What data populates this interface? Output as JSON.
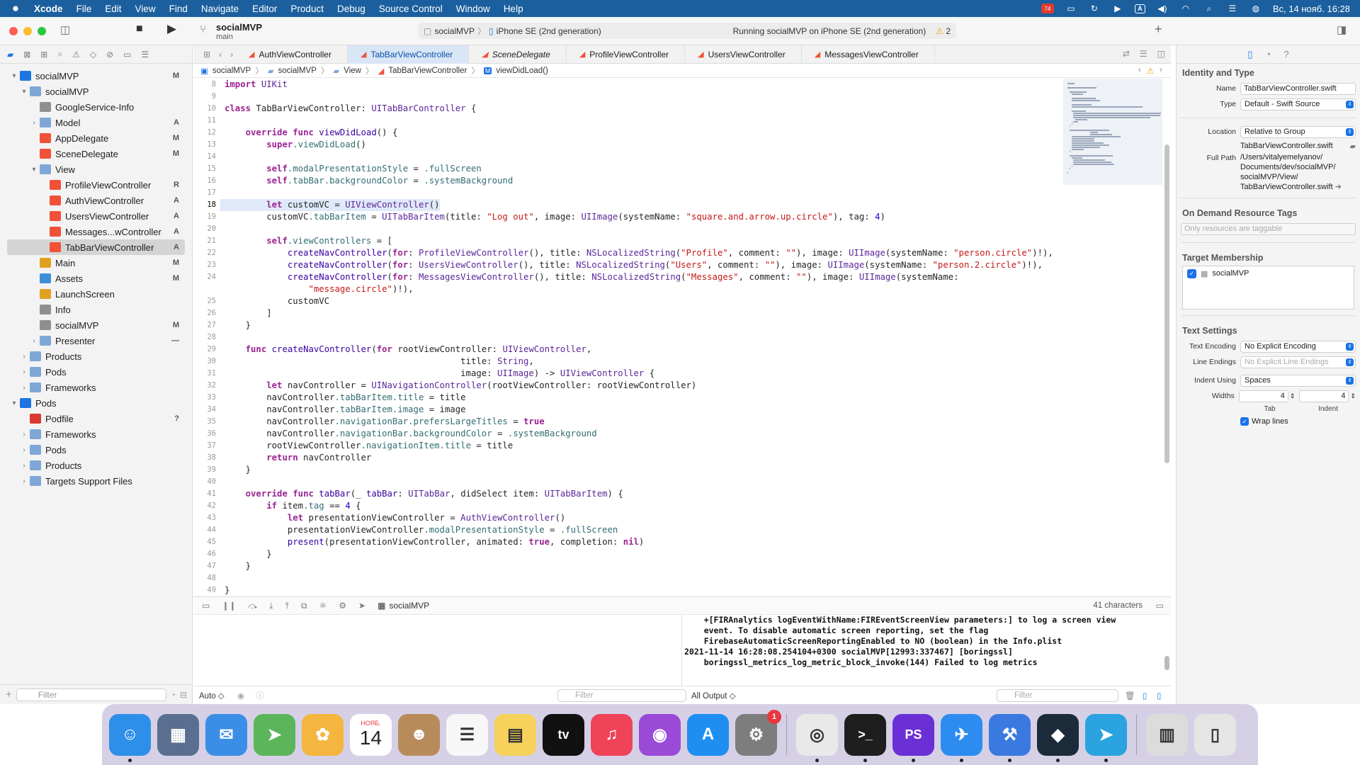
{
  "menubar": {
    "apple": "",
    "items": [
      "Xcode",
      "File",
      "Edit",
      "View",
      "Find",
      "Navigate",
      "Editor",
      "Product",
      "Debug",
      "Source Control",
      "Window",
      "Help"
    ],
    "date_time": "Вс, 14 нояб.  16:28",
    "status_badge": "74"
  },
  "toolbar": {
    "project_name": "socialMVP",
    "branch": "main",
    "destination_scheme": "socialMVP",
    "destination_device": "iPhone SE (2nd generation)",
    "status": "Running socialMVP on iPhone SE (2nd generation)",
    "warnings": "2"
  },
  "navigator": {
    "items": [
      {
        "label": "socialMVP",
        "icon": "project-icon",
        "indent": 0,
        "disc": "▾",
        "badge": "M"
      },
      {
        "label": "socialMVP",
        "icon": "folder-icon",
        "indent": 1,
        "disc": "▾",
        "badge": ""
      },
      {
        "label": "GoogleService-Info",
        "icon": "plist-icon",
        "indent": 2,
        "disc": "",
        "badge": ""
      },
      {
        "label": "Model",
        "icon": "folder-icon",
        "indent": 2,
        "disc": "›",
        "badge": "A"
      },
      {
        "label": "AppDelegate",
        "icon": "swift-icon",
        "indent": 2,
        "disc": "",
        "badge": "M"
      },
      {
        "label": "SceneDelegate",
        "icon": "swift-icon",
        "indent": 2,
        "disc": "",
        "badge": "M"
      },
      {
        "label": "View",
        "icon": "folder-icon",
        "indent": 2,
        "disc": "▾",
        "badge": ""
      },
      {
        "label": "ProfileViewController",
        "icon": "swift-icon",
        "indent": 3,
        "disc": "",
        "badge": "R"
      },
      {
        "label": "AuthViewController",
        "icon": "swift-icon",
        "indent": 3,
        "disc": "",
        "badge": "A"
      },
      {
        "label": "UsersViewController",
        "icon": "swift-icon",
        "indent": 3,
        "disc": "",
        "badge": "A"
      },
      {
        "label": "Messages...wController",
        "icon": "swift-icon",
        "indent": 3,
        "disc": "",
        "badge": "A"
      },
      {
        "label": "TabBarViewController",
        "icon": "swift-icon",
        "indent": 3,
        "disc": "",
        "badge": "A",
        "selected": true
      },
      {
        "label": "Main",
        "icon": "xib-icon",
        "indent": 2,
        "disc": "",
        "badge": "M"
      },
      {
        "label": "Assets",
        "icon": "assets-icon",
        "indent": 2,
        "disc": "",
        "badge": "M"
      },
      {
        "label": "LaunchScreen",
        "icon": "xib-icon",
        "indent": 2,
        "disc": "",
        "badge": ""
      },
      {
        "label": "Info",
        "icon": "plist-icon",
        "indent": 2,
        "disc": "",
        "badge": ""
      },
      {
        "label": "socialMVP",
        "icon": "plist-icon",
        "indent": 2,
        "disc": "",
        "badge": "M"
      },
      {
        "label": "Presenter",
        "icon": "folder-icon",
        "indent": 2,
        "disc": "›",
        "badge": "—"
      },
      {
        "label": "Products",
        "icon": "folder-icon",
        "indent": 1,
        "disc": "›",
        "badge": ""
      },
      {
        "label": "Pods",
        "icon": "folder-icon",
        "indent": 1,
        "disc": "›",
        "badge": ""
      },
      {
        "label": "Frameworks",
        "icon": "folder-icon",
        "indent": 1,
        "disc": "›",
        "badge": ""
      },
      {
        "label": "Pods",
        "icon": "project-icon",
        "indent": 0,
        "disc": "▾",
        "badge": ""
      },
      {
        "label": "Podfile",
        "icon": "pod-icon",
        "indent": 1,
        "disc": "",
        "badge": "?"
      },
      {
        "label": "Frameworks",
        "icon": "folder-icon",
        "indent": 1,
        "disc": "›",
        "badge": ""
      },
      {
        "label": "Pods",
        "icon": "folder-icon",
        "indent": 1,
        "disc": "›",
        "badge": ""
      },
      {
        "label": "Products",
        "icon": "folder-icon",
        "indent": 1,
        "disc": "›",
        "badge": ""
      },
      {
        "label": "Targets Support Files",
        "icon": "folder-icon",
        "indent": 1,
        "disc": "›",
        "badge": ""
      }
    ],
    "filter_placeholder": "Filter"
  },
  "tabs": [
    {
      "label": "AuthViewController",
      "active": false,
      "italic": false
    },
    {
      "label": "TabBarViewController",
      "active": true,
      "italic": false
    },
    {
      "label": "SceneDelegate",
      "active": false,
      "italic": true
    },
    {
      "label": "ProfileViewController",
      "active": false,
      "italic": false
    },
    {
      "label": "UsersViewController",
      "active": false,
      "italic": false
    },
    {
      "label": "MessagesViewController",
      "active": false,
      "italic": false
    }
  ],
  "jumpbar": [
    "socialMVP",
    "socialMVP",
    "View",
    "TabBarViewController",
    "viewDidLoad()"
  ],
  "code": [
    {
      "n": "8",
      "t": "import UIKit"
    },
    {
      "n": "9",
      "t": ""
    },
    {
      "n": "10",
      "t": "class TabBarViewController: UITabBarController {"
    },
    {
      "n": "11",
      "t": ""
    },
    {
      "n": "12",
      "t": "    override func viewDidLoad() {"
    },
    {
      "n": "13",
      "t": "        super.viewDidLoad()"
    },
    {
      "n": "14",
      "t": ""
    },
    {
      "n": "15",
      "t": "        self.modalPresentationStyle = .fullScreen"
    },
    {
      "n": "16",
      "t": "        self.tabBar.backgroundColor = .systemBackground"
    },
    {
      "n": "17",
      "t": ""
    },
    {
      "n": "18",
      "t": "        let customVC = UIViewController()",
      "hl": true
    },
    {
      "n": "19",
      "t": "        customVC.tabBarItem = UITabBarItem(title: \"Log out\", image: UIImage(systemName: \"square.and.arrow.up.circle\"), tag: 4)"
    },
    {
      "n": "20",
      "t": ""
    },
    {
      "n": "21",
      "t": "        self.viewControllers = ["
    },
    {
      "n": "22",
      "t": "            createNavController(for: ProfileViewController(), title: NSLocalizedString(\"Profile\", comment: \"\"), image: UIImage(systemName: \"person.circle\")!),"
    },
    {
      "n": "23",
      "t": "            createNavController(for: UsersViewController(), title: NSLocalizedString(\"Users\", comment: \"\"), image: UIImage(systemName: \"person.2.circle\")!),"
    },
    {
      "n": "24",
      "t": "            createNavController(for: MessagesViewController(), title: NSLocalizedString(\"Messages\", comment: \"\"), image: UIImage(systemName:"
    },
    {
      "n": "",
      "t": "                \"message.circle\")!),"
    },
    {
      "n": "25",
      "t": "            customVC"
    },
    {
      "n": "26",
      "t": "        ]"
    },
    {
      "n": "27",
      "t": "    }"
    },
    {
      "n": "28",
      "t": ""
    },
    {
      "n": "29",
      "t": "    func createNavController(for rootViewController: UIViewController,"
    },
    {
      "n": "30",
      "t": "                                             title: String,"
    },
    {
      "n": "31",
      "t": "                                             image: UIImage) -> UIViewController {"
    },
    {
      "n": "32",
      "t": "        let navController = UINavigationController(rootViewController: rootViewController)"
    },
    {
      "n": "33",
      "t": "        navController.tabBarItem.title = title"
    },
    {
      "n": "34",
      "t": "        navController.tabBarItem.image = image"
    },
    {
      "n": "35",
      "t": "        navController.navigationBar.prefersLargeTitles = true"
    },
    {
      "n": "36",
      "t": "        navController.navigationBar.backgroundColor = .systemBackground"
    },
    {
      "n": "37",
      "t": "        rootViewController.navigationItem.title = title"
    },
    {
      "n": "38",
      "t": "        return navController"
    },
    {
      "n": "39",
      "t": "    }"
    },
    {
      "n": "40",
      "t": ""
    },
    {
      "n": "41",
      "t": "    override func tabBar(_ tabBar: UITabBar, didSelect item: UITabBarItem) {"
    },
    {
      "n": "42",
      "t": "        if item.tag == 4 {"
    },
    {
      "n": "43",
      "t": "            let presentationViewController = AuthViewController()"
    },
    {
      "n": "44",
      "t": "            presentationViewController.modalPresentationStyle = .fullScreen"
    },
    {
      "n": "45",
      "t": "            present(presentationViewController, animated: true, completion: nil)"
    },
    {
      "n": "46",
      "t": "        }"
    },
    {
      "n": "47",
      "t": "    }"
    },
    {
      "n": "48",
      "t": ""
    },
    {
      "n": "49",
      "t": "}"
    }
  ],
  "debugbar": {
    "target": "socialMVP",
    "chars": "41 characters"
  },
  "console": {
    "lines": [
      "    +[FIRAnalytics logEventWithName:FIREventScreenView parameters:] to log a screen view",
      "    event. To disable automatic screen reporting, set the flag",
      "    FirebaseAutomaticScreenReportingEnabled to NO (boolean) in the Info.plist",
      "2021-11-14 16:28:08.254104+0300 socialMVP[12993:337467] [boringssl]",
      "    boringssl_metrics_log_metric_block_invoke(144) Failed to log metrics"
    ],
    "auto_label": "Auto ◇",
    "output_label": "All Output ◇",
    "filter_left": "Filter",
    "filter_right": "Filter"
  },
  "inspector": {
    "identity_title": "Identity and Type",
    "name_label": "Name",
    "name_value": "TabBarViewController.swift",
    "type_label": "Type",
    "type_value": "Default - Swift Source",
    "location_label": "Location",
    "location_value": "Relative to Group",
    "location_file": "TabBarViewController.swift",
    "fullpath_label": "Full Path",
    "fullpath_lines": [
      "/Users/vitalyemelyanov/",
      "Documents/dev/socialMVP/",
      "socialMVP/View/",
      "TabBarViewController.swift"
    ],
    "ondemand_title": "On Demand Resource Tags",
    "ondemand_placeholder": "Only resources are taggable",
    "target_title": "Target Membership",
    "target_item": "socialMVP",
    "text_title": "Text Settings",
    "encoding_label": "Text Encoding",
    "encoding_value": "No Explicit Encoding",
    "endings_label": "Line Endings",
    "endings_value": "No Explicit Line Endings",
    "indent_label": "Indent Using",
    "indent_value": "Spaces",
    "widths_label": "Widths",
    "tab_value": "4",
    "indent_width_value": "4",
    "tab_caption": "Tab",
    "indent_caption": "Indent",
    "wrap_label": "Wrap lines"
  },
  "dock": {
    "items": [
      {
        "name": "finder-icon",
        "color": "#2e8fe8",
        "glyph": "☺",
        "running": true
      },
      {
        "name": "launchpad-icon",
        "color": "#5a6f8f",
        "glyph": "▦",
        "running": false
      },
      {
        "name": "mail-icon",
        "color": "#3a8ee6",
        "glyph": "✉",
        "running": false
      },
      {
        "name": "maps-icon",
        "color": "#5bb55b",
        "glyph": "➤",
        "running": false
      },
      {
        "name": "photos-icon",
        "color": "#f4b63f",
        "glyph": "✿",
        "running": false
      },
      {
        "name": "calendar-icon",
        "color": "#ffffff",
        "glyph": "14",
        "running": false
      },
      {
        "name": "contacts-icon",
        "color": "#b88c5a",
        "glyph": "☻",
        "running": false
      },
      {
        "name": "reminders-icon",
        "color": "#f7f7f7",
        "glyph": "☰",
        "running": false
      },
      {
        "name": "notes-icon",
        "color": "#f6d15b",
        "glyph": "▤",
        "running": false
      },
      {
        "name": "tv-icon",
        "color": "#111111",
        "glyph": "tv",
        "running": false
      },
      {
        "name": "music-icon",
        "color": "#f0435a",
        "glyph": "♫",
        "running": false
      },
      {
        "name": "podcasts-icon",
        "color": "#9b4ad8",
        "glyph": "◉",
        "running": false
      },
      {
        "name": "appstore-icon",
        "color": "#1e8ef0",
        "glyph": "A",
        "running": false
      },
      {
        "name": "system-preferences-icon",
        "color": "#7d7d7d",
        "glyph": "⚙",
        "running": false,
        "badge": "1"
      },
      {
        "name": "chrome-icon",
        "color": "#e9e9e9",
        "glyph": "◎",
        "running": true
      },
      {
        "name": "terminal-icon",
        "color": "#1e1e1e",
        "glyph": ">_",
        "running": true
      },
      {
        "name": "phpstorm-icon",
        "color": "#6b2fd6",
        "glyph": "PS",
        "running": true
      },
      {
        "name": "xcode-icon",
        "color": "#2d8cf0",
        "glyph": "✈",
        "running": true
      },
      {
        "name": "instruments-icon",
        "color": "#3a7ae0",
        "glyph": "⚒",
        "running": true
      },
      {
        "name": "sourcetree-icon",
        "color": "#1b2b3a",
        "glyph": "◆",
        "running": true
      },
      {
        "name": "telegram-icon",
        "color": "#2aa3e0",
        "glyph": "➤",
        "running": true
      },
      {
        "name": "downloads-icon",
        "color": "#dcdcdc",
        "glyph": "▥",
        "running": false
      },
      {
        "name": "trash-icon",
        "color": "#e5e5e5",
        "glyph": "▯",
        "running": false
      }
    ],
    "calendar_month": "НОЯБ."
  }
}
